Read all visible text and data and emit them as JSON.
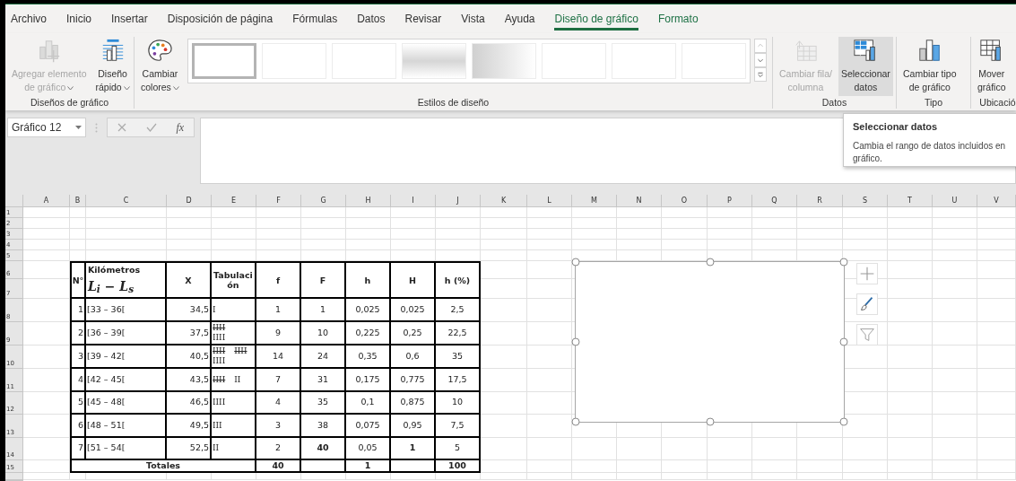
{
  "tabs": [
    {
      "label": "Archivo",
      "selected": false,
      "contextual": false
    },
    {
      "label": "Inicio",
      "selected": false,
      "contextual": false
    },
    {
      "label": "Insertar",
      "selected": false,
      "contextual": false
    },
    {
      "label": "Disposición de página",
      "selected": false,
      "contextual": false
    },
    {
      "label": "Fórmulas",
      "selected": false,
      "contextual": false
    },
    {
      "label": "Datos",
      "selected": false,
      "contextual": false
    },
    {
      "label": "Revisar",
      "selected": false,
      "contextual": false
    },
    {
      "label": "Vista",
      "selected": false,
      "contextual": false
    },
    {
      "label": "Ayuda",
      "selected": false,
      "contextual": false
    },
    {
      "label": "Diseño de gráfico",
      "selected": true,
      "contextual": true
    },
    {
      "label": "Formato",
      "selected": false,
      "contextual": true
    }
  ],
  "ribbon": {
    "groups": [
      {
        "label": "Diseños de gráfico",
        "buttons": [
          {
            "lines": [
              "Agregar elemento",
              "de gráfico"
            ],
            "dropdown": true,
            "disabled": true,
            "highlighted": false
          },
          {
            "lines": [
              "Diseño",
              "rápido"
            ],
            "dropdown": true,
            "disabled": false,
            "highlighted": false
          }
        ]
      },
      {
        "label": "Estilos de diseño",
        "buttons": [
          {
            "lines": [
              "Cambiar",
              "colores"
            ],
            "dropdown": true,
            "disabled": false,
            "highlighted": false
          }
        ],
        "gallery": [
          {
            "kind": "plain",
            "selected": true
          },
          {
            "kind": "plain",
            "selected": false
          },
          {
            "kind": "plain",
            "selected": false
          },
          {
            "kind": "light",
            "selected": false
          },
          {
            "kind": "dark",
            "selected": false
          },
          {
            "kind": "plain",
            "selected": false
          },
          {
            "kind": "plain",
            "selected": false
          },
          {
            "kind": "plain",
            "selected": false
          }
        ]
      },
      {
        "label": "Datos",
        "buttons": [
          {
            "lines": [
              "Cambiar fila/",
              "columna"
            ],
            "dropdown": false,
            "disabled": true,
            "highlighted": false
          },
          {
            "lines": [
              "Seleccionar",
              "datos"
            ],
            "dropdown": false,
            "disabled": false,
            "highlighted": true
          }
        ]
      },
      {
        "label": "Tipo",
        "buttons": [
          {
            "lines": [
              "Cambiar tipo",
              "de gráfico"
            ],
            "dropdown": false,
            "disabled": false,
            "highlighted": false
          }
        ]
      },
      {
        "label": "Ubicació",
        "buttons": [
          {
            "lines": [
              "Mover",
              "gráfico"
            ],
            "dropdown": false,
            "disabled": false,
            "highlighted": false
          }
        ]
      }
    ]
  },
  "formula_bar": {
    "name_box": "Gráfico 12",
    "function_label": "fx"
  },
  "tooltip": {
    "title": "Seleccionar datos",
    "text": "Cambia el rango de datos incluidos en gráfico."
  },
  "sheet": {
    "column_headers": [
      "A",
      "B",
      "C",
      "D",
      "E",
      "F",
      "G",
      "H",
      "I",
      "J",
      "K",
      "L",
      "M",
      "N",
      "O",
      "P",
      "Q",
      "R",
      "S",
      "T",
      "U",
      "V"
    ],
    "row_headers": [
      "1",
      "2",
      "3",
      "4",
      "5",
      "6",
      "7",
      "8",
      "9",
      "10",
      "11",
      "12",
      "13",
      "14",
      "15"
    ]
  },
  "table": {
    "columns": [
      {
        "label": "N°"
      },
      {
        "label": "Kilómetros",
        "formula": "L$_{i}$ − L$_{s}$"
      },
      {
        "label": "X"
      },
      {
        "label": "Tabulación"
      },
      {
        "label": "f"
      },
      {
        "label": "F"
      },
      {
        "label": "h"
      },
      {
        "label": "H"
      },
      {
        "label": "h (%)"
      }
    ],
    "rows": [
      {
        "values": [
          "1",
          "[33 – 36[",
          "34,5",
          "1",
          "1",
          "0,025",
          "0,025",
          "2,5"
        ],
        "bold": [
          false,
          false,
          false,
          false,
          false,
          false,
          false,
          false
        ],
        "tally": [
          [
            {
              "text": "I",
              "struck": false
            }
          ]
        ]
      },
      {
        "values": [
          "2",
          "[36 – 39[",
          "37,5",
          "9",
          "10",
          "0,225",
          "0,25",
          "22,5"
        ],
        "bold": [
          false,
          false,
          false,
          false,
          false,
          false,
          false,
          false
        ],
        "tally": [
          [
            {
              "text": "IIII",
              "struck": true
            }
          ],
          [
            {
              "text": "IIII",
              "struck": false
            }
          ]
        ]
      },
      {
        "values": [
          "3",
          "[39 – 42[",
          "40,5",
          "14",
          "24",
          "0,35",
          "0,6",
          "35"
        ],
        "bold": [
          false,
          false,
          false,
          false,
          false,
          false,
          false,
          false
        ],
        "tally": [
          [
            {
              "text": "IIII",
              "struck": true
            },
            {
              "text": "IIII",
              "struck": true
            }
          ],
          [
            {
              "text": "IIII",
              "struck": false
            }
          ]
        ]
      },
      {
        "values": [
          "4",
          "[42 – 45[",
          "43,5",
          "7",
          "31",
          "0,175",
          "0,775",
          "17,5"
        ],
        "bold": [
          false,
          false,
          false,
          false,
          false,
          false,
          false,
          false
        ],
        "tally": [
          [
            {
              "text": "IIII",
              "struck": true
            },
            {
              "text": "II",
              "struck": false
            }
          ]
        ]
      },
      {
        "values": [
          "5",
          "[45 – 48[",
          "46,5",
          "4",
          "35",
          "0,1",
          "0,875",
          "10"
        ],
        "bold": [
          false,
          false,
          false,
          false,
          false,
          false,
          false,
          false
        ],
        "tally": [
          [
            {
              "text": "IIII",
              "struck": false
            }
          ]
        ]
      },
      {
        "values": [
          "6",
          "[48 – 51[",
          "49,5",
          "3",
          "38",
          "0,075",
          "0,95",
          "7,5"
        ],
        "bold": [
          false,
          false,
          false,
          false,
          false,
          false,
          false,
          false
        ],
        "tally": [
          [
            {
              "text": "III",
              "struck": false
            }
          ]
        ]
      },
      {
        "values": [
          "7",
          "[51 – 54[",
          "52,5",
          "2",
          "40",
          "0,05",
          "1",
          "5"
        ],
        "bold": [
          false,
          false,
          false,
          false,
          true,
          false,
          true,
          false
        ],
        "tally": [
          [
            {
              "text": "II",
              "struck": false
            }
          ]
        ]
      }
    ],
    "totals": {
      "label": "Totales",
      "f": "40",
      "h": "1",
      "h_pct": "100"
    }
  },
  "chart": {
    "selected": true
  }
}
